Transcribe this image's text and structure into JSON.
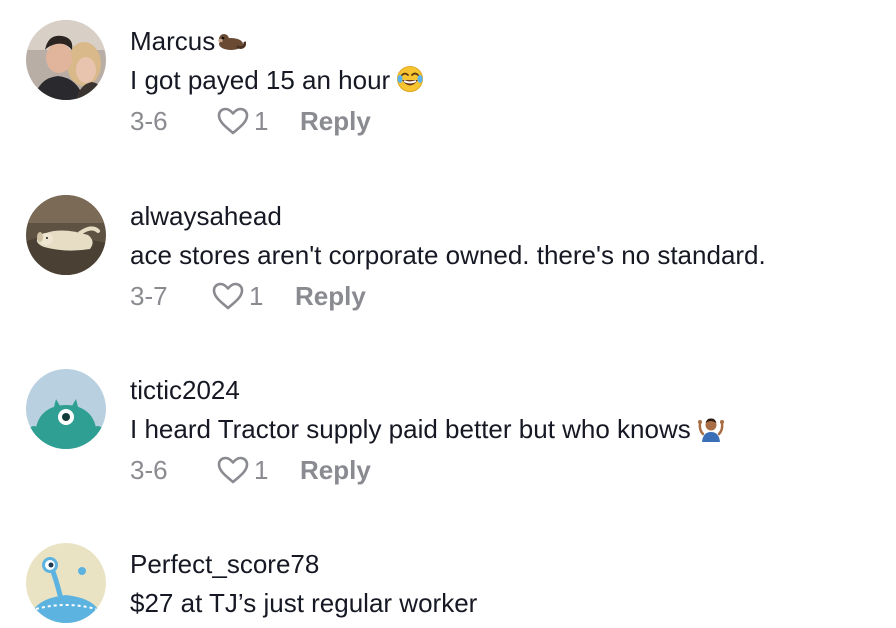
{
  "comments": [
    {
      "username": "Marcus",
      "username_emoji": "otter-icon",
      "text": "I got payed 15 an hour",
      "text_emoji": "laughing-emoji-icon",
      "date": "3-6",
      "likes": "1",
      "reply_label": "Reply"
    },
    {
      "username": "alwaysahead",
      "text": "ace stores aren't corporate owned. there's no standard.",
      "date": "3-7",
      "likes": "1",
      "reply_label": "Reply"
    },
    {
      "username": "tictic2024",
      "text": "I heard Tractor supply paid better but who knows",
      "text_emoji": "shrug-emoji-icon",
      "date": "3-6",
      "likes": "1",
      "reply_label": "Reply"
    },
    {
      "username": "Perfect_score78",
      "text": "$27 at TJ’s just regular worker"
    }
  ],
  "colors": {
    "text_primary": "#161823",
    "text_secondary": "#8a8b91",
    "background": "#ffffff"
  }
}
